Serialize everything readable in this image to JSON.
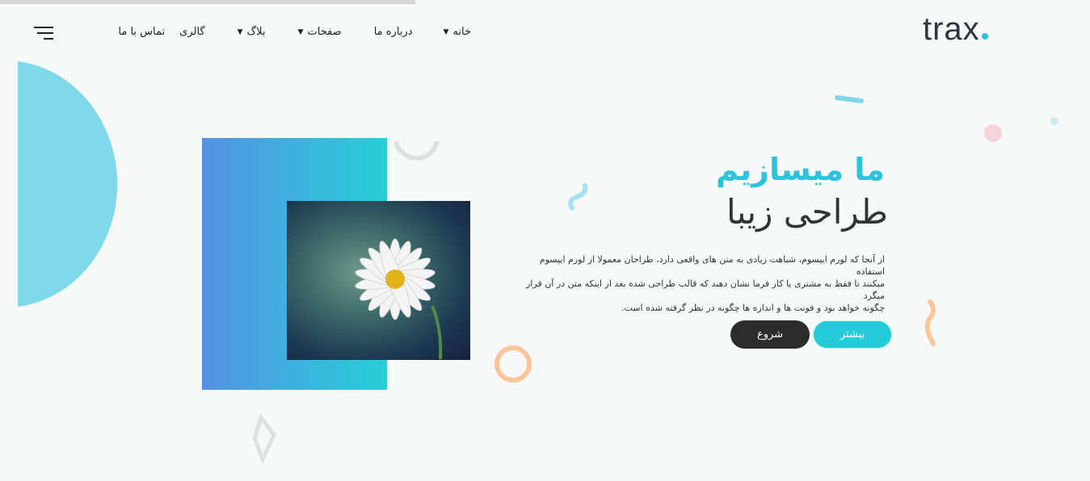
{
  "logo": {
    "text": "trax"
  },
  "nav": {
    "items": [
      {
        "label": "خانه",
        "dropdown": true
      },
      {
        "label": "درباره ما",
        "dropdown": false
      },
      {
        "label": "صفحات",
        "dropdown": true
      },
      {
        "label": "بلاگ",
        "dropdown": true
      },
      {
        "label": "گالری",
        "dropdown": false
      },
      {
        "label": "تماس با ما",
        "dropdown": false
      }
    ]
  },
  "hero": {
    "title_line1": "ما میسازیم",
    "title_line2": "طراحی زیبا",
    "paragraph_lines": [
      "از آنجا که لورم ایپسوم، شباهت زیادی به متن های واقعی دارد، طراحان معمولا از لورم ایپسوم استفاده",
      "میکنند تا فقط به مشتری یا کار فرما نشان دهند که قالب طراحی شده بعد از اینکه متن در آن قرار میگرد",
      "چگونه خواهد بود و فونت ها و اندازه ها چگونه در نظر گرفته شده است."
    ],
    "more_button": "بیشتر",
    "start_button": "شروع"
  },
  "colors": {
    "accent": "#25cbd8",
    "dark": "#2c2c2c"
  }
}
